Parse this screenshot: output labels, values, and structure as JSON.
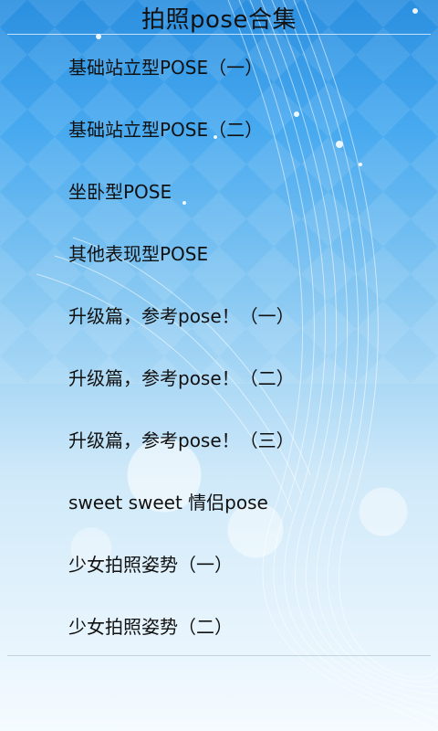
{
  "header": {
    "title": "拍照pose合集"
  },
  "menu": {
    "items": [
      {
        "label": "基础站立型POSE（一）"
      },
      {
        "label": "基础站立型POSE（二）"
      },
      {
        "label": "坐卧型POSE"
      },
      {
        "label": "其他表现型POSE"
      },
      {
        "label": "升级篇，参考pose！（一）"
      },
      {
        "label": "升级篇，参考pose！（二）"
      },
      {
        "label": "升级篇，参考pose！（三）"
      },
      {
        "label": "sweet sweet 情侣pose"
      },
      {
        "label": "少女拍照姿势（一）"
      },
      {
        "label": "少女拍照姿势（二）"
      }
    ]
  },
  "colors": {
    "text": "#111111",
    "sky_top": "#2b8fe0",
    "sky_bottom": "#f5fbff"
  }
}
